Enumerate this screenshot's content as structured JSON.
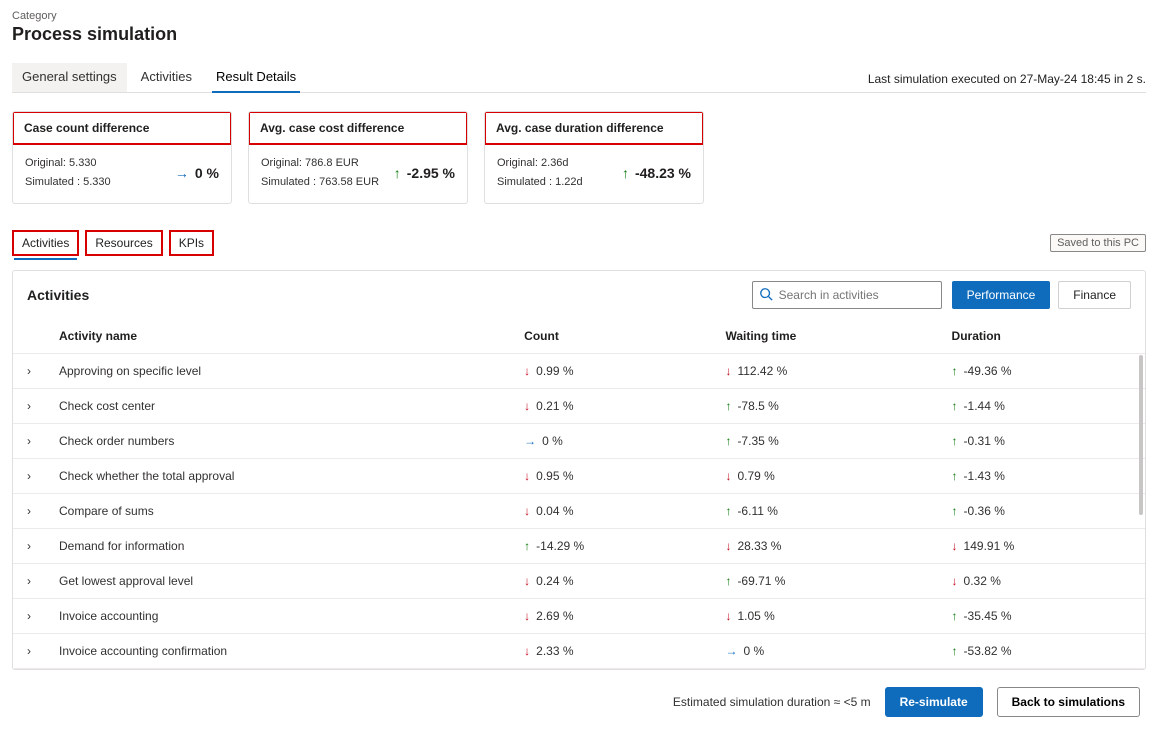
{
  "category_label": "Category",
  "page_title": "Process simulation",
  "tabs": {
    "general": "General settings",
    "activities": "Activities",
    "result_details": "Result Details"
  },
  "last_run": "Last simulation executed on 27-May-24 18:45 in 2 s.",
  "cards": [
    {
      "title": "Case count difference",
      "original": "Original: 5.330",
      "simulated": "Simulated : 5.330",
      "arrow": "neutral",
      "value": "0 %"
    },
    {
      "title": "Avg. case cost difference",
      "original": "Original: 786.8 EUR",
      "simulated": "Simulated : 763.58 EUR",
      "arrow": "up",
      "value": "-2.95 %"
    },
    {
      "title": "Avg. case duration difference",
      "original": "Original: 2.36d",
      "simulated": "Simulated : 1.22d",
      "arrow": "up",
      "value": "-48.23 %"
    }
  ],
  "sub_tabs": {
    "activities": "Activities",
    "resources": "Resources",
    "kpis": "KPIs"
  },
  "saved_chip": "Saved to this PC",
  "panel_title": "Activities",
  "search_placeholder": "Search in activities",
  "view_toggle": {
    "performance": "Performance",
    "finance": "Finance"
  },
  "columns": {
    "name": "Activity name",
    "count": "Count",
    "waiting": "Waiting time",
    "duration": "Duration"
  },
  "rows": [
    {
      "name": "Approving on specific level",
      "count": {
        "dir": "down",
        "val": "0.99 %"
      },
      "waiting": {
        "dir": "down",
        "val": "112.42 %"
      },
      "duration": {
        "dir": "up",
        "val": "-49.36 %"
      }
    },
    {
      "name": "Check cost center",
      "count": {
        "dir": "down",
        "val": "0.21 %"
      },
      "waiting": {
        "dir": "up",
        "val": "-78.5 %"
      },
      "duration": {
        "dir": "up",
        "val": "-1.44 %"
      }
    },
    {
      "name": "Check order numbers",
      "count": {
        "dir": "neutral",
        "val": "0 %"
      },
      "waiting": {
        "dir": "up",
        "val": "-7.35 %"
      },
      "duration": {
        "dir": "up",
        "val": "-0.31 %"
      }
    },
    {
      "name": "Check whether the total approval",
      "count": {
        "dir": "down",
        "val": "0.95 %"
      },
      "waiting": {
        "dir": "down",
        "val": "0.79 %"
      },
      "duration": {
        "dir": "up",
        "val": "-1.43 %"
      }
    },
    {
      "name": "Compare of sums",
      "count": {
        "dir": "down",
        "val": "0.04 %"
      },
      "waiting": {
        "dir": "up",
        "val": "-6.11 %"
      },
      "duration": {
        "dir": "up",
        "val": "-0.36 %"
      }
    },
    {
      "name": "Demand for information",
      "count": {
        "dir": "up",
        "val": "-14.29 %"
      },
      "waiting": {
        "dir": "down",
        "val": "28.33 %"
      },
      "duration": {
        "dir": "down",
        "val": "149.91 %"
      }
    },
    {
      "name": "Get lowest approval level",
      "count": {
        "dir": "down",
        "val": "0.24 %"
      },
      "waiting": {
        "dir": "up",
        "val": "-69.71 %"
      },
      "duration": {
        "dir": "down",
        "val": "0.32 %"
      }
    },
    {
      "name": "Invoice accounting",
      "count": {
        "dir": "down",
        "val": "2.69 %"
      },
      "waiting": {
        "dir": "down",
        "val": "1.05 %"
      },
      "duration": {
        "dir": "up",
        "val": "-35.45 %"
      }
    },
    {
      "name": "Invoice accounting confirmation",
      "count": {
        "dir": "down",
        "val": "2.33 %"
      },
      "waiting": {
        "dir": "neutral",
        "val": "0 %"
      },
      "duration": {
        "dir": "up",
        "val": "-53.82 %"
      }
    }
  ],
  "footer": {
    "estimate": "Estimated simulation duration ≈ <5 m",
    "resimulate": "Re-simulate",
    "back": "Back to simulations"
  }
}
